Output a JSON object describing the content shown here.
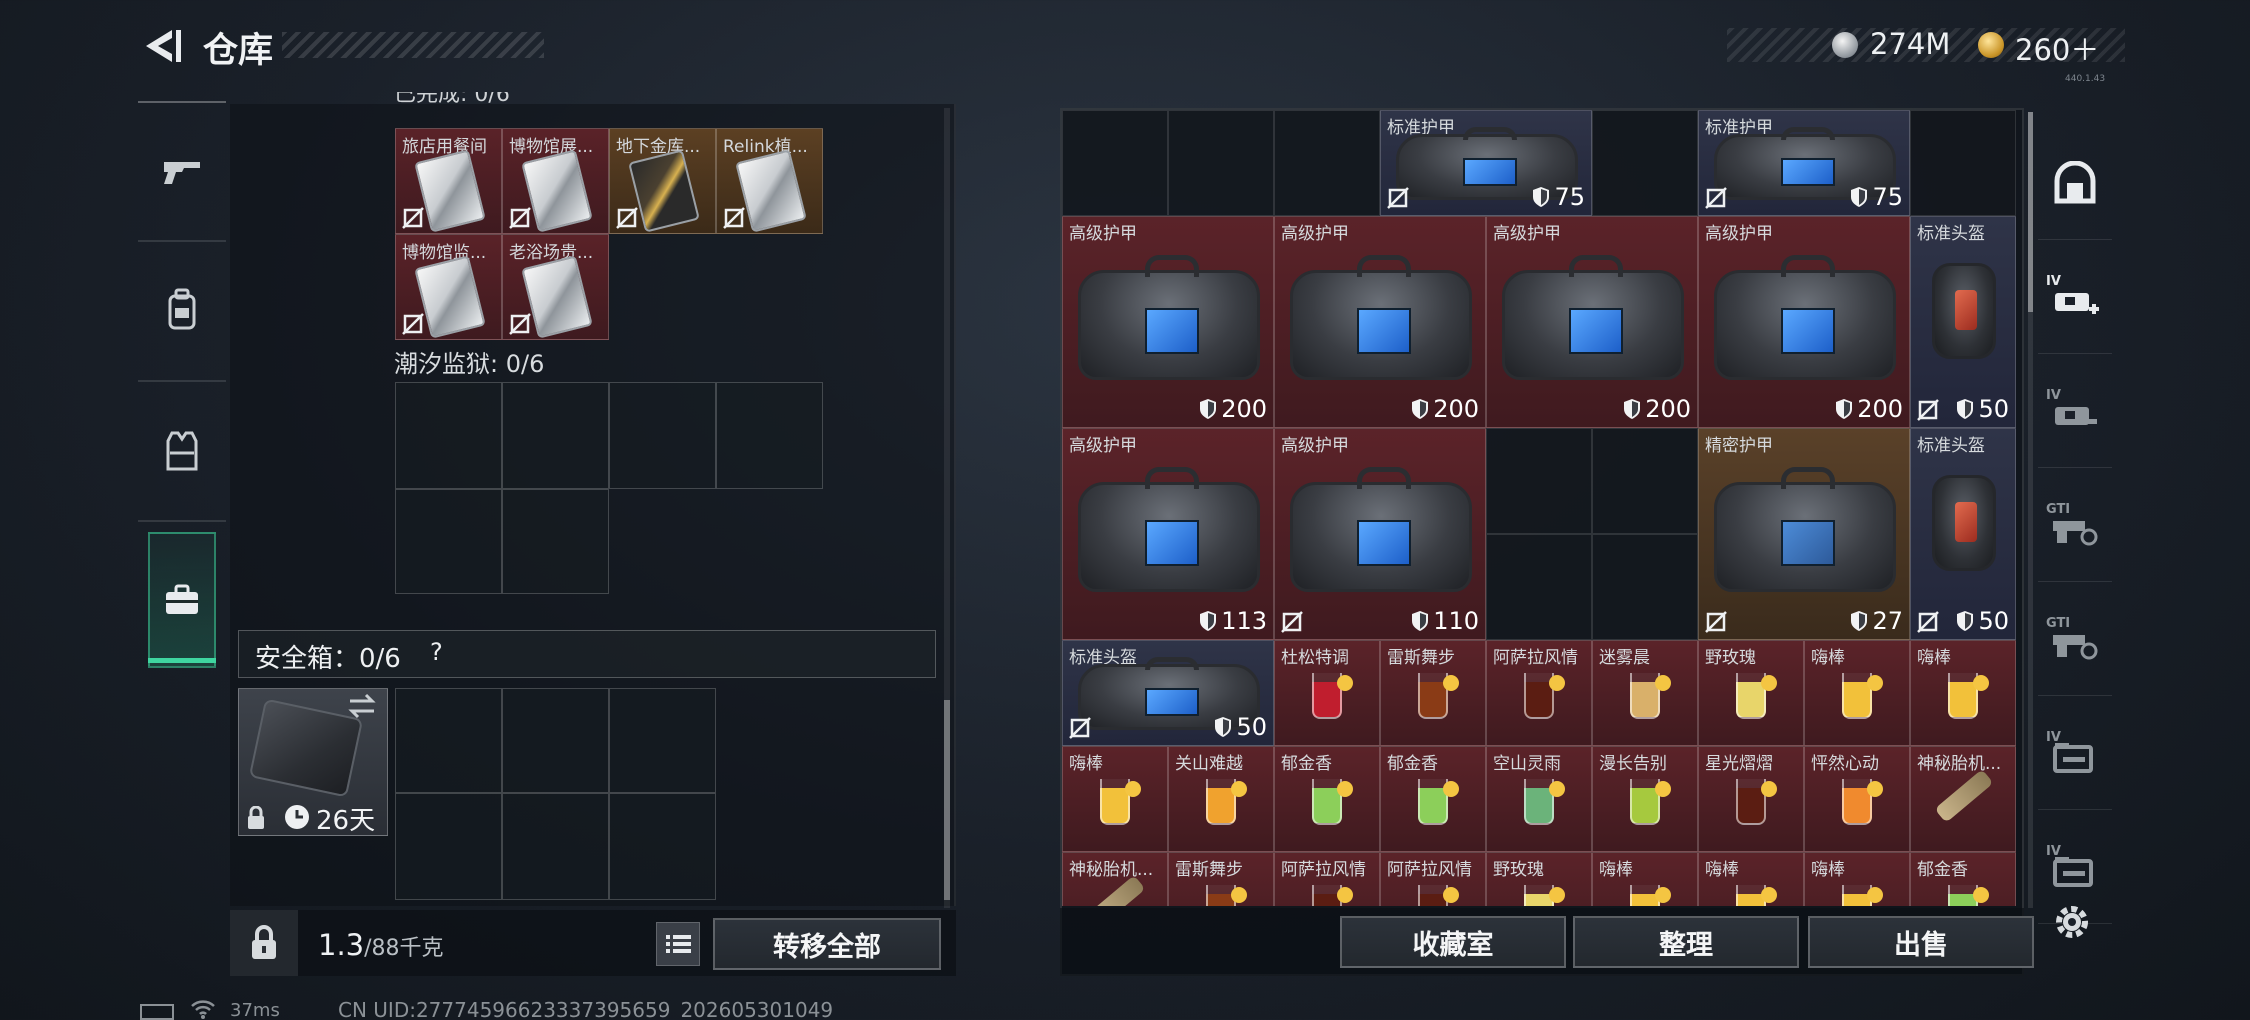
{
  "header": {
    "title": "仓库",
    "currency_silver": "274M",
    "currency_gold": "260＋",
    "tiny_text": "440.1.43"
  },
  "left_nav": {
    "items": [
      "weapons-icon",
      "backpack-icon",
      "vest-icon",
      "toolbox-icon"
    ],
    "active": "toolbox-icon"
  },
  "left_panel": {
    "cut_label": "已完成: 0/6",
    "cards": [
      {
        "name": "旅店用餐间",
        "tone": "red",
        "style": "white"
      },
      {
        "name": "博物馆展...",
        "tone": "red",
        "style": "white"
      },
      {
        "name": "地下金库...",
        "tone": "gold",
        "style": "black"
      },
      {
        "name": "Relink植...",
        "tone": "gold",
        "style": "white"
      },
      {
        "name": "博物馆监...",
        "tone": "red",
        "style": "white"
      },
      {
        "name": "老浴场贵...",
        "tone": "red",
        "style": "white"
      }
    ],
    "prison_label": "潮汐监狱: 0/6",
    "safe_box_label": "安全箱：0/6",
    "safe_help": "?",
    "case_days": "26天",
    "weight_value": "1.3",
    "weight_unit": "/88千克",
    "transfer_button": "转移全部"
  },
  "grid": {
    "items": [
      {
        "name": "标准护甲",
        "kind": "bag",
        "tone": "blue",
        "col": 3,
        "row": 0,
        "w": 2,
        "h": 1,
        "dur": "75",
        "noseal": true
      },
      {
        "name": "标准护甲",
        "kind": "bag",
        "tone": "blue",
        "col": 6,
        "row": 0,
        "w": 2,
        "h": 1,
        "dur": "75",
        "noseal": true
      },
      {
        "name": "高级护甲",
        "kind": "bag",
        "tone": "red",
        "col": 0,
        "row": 1,
        "w": 2,
        "h": 2,
        "dur": "200",
        "noseal": false
      },
      {
        "name": "高级护甲",
        "kind": "bag",
        "tone": "red",
        "col": 2,
        "row": 1,
        "w": 2,
        "h": 2,
        "dur": "200",
        "noseal": false
      },
      {
        "name": "高级护甲",
        "kind": "bag",
        "tone": "red",
        "col": 4,
        "row": 1,
        "w": 2,
        "h": 2,
        "dur": "200",
        "noseal": false
      },
      {
        "name": "高级护甲",
        "kind": "bag",
        "tone": "red",
        "col": 6,
        "row": 1,
        "w": 2,
        "h": 2,
        "dur": "200",
        "noseal": false
      },
      {
        "name": "标准头盔",
        "kind": "helmet",
        "tone": "blue",
        "col": 8,
        "row": 1,
        "w": 1,
        "h": 2,
        "dur": "50",
        "noseal": true
      },
      {
        "name": "高级护甲",
        "kind": "bag",
        "tone": "red",
        "col": 0,
        "row": 3,
        "w": 2,
        "h": 2,
        "dur": "113",
        "noseal": false
      },
      {
        "name": "高级护甲",
        "kind": "bag",
        "tone": "red",
        "col": 2,
        "row": 3,
        "w": 2,
        "h": 2,
        "dur": "110",
        "noseal": true
      },
      {
        "name": "精密护甲",
        "kind": "bag",
        "tone": "gold",
        "col": 6,
        "row": 3,
        "w": 2,
        "h": 2,
        "dur": "27",
        "noseal": true
      },
      {
        "name": "标准头盔",
        "kind": "helmet",
        "tone": "blue",
        "col": 8,
        "row": 3,
        "w": 1,
        "h": 2,
        "dur": "50",
        "noseal": true
      },
      {
        "name": "标准头盔",
        "kind": "bag",
        "tone": "blue",
        "col": 0,
        "row": 5,
        "w": 2,
        "h": 1,
        "dur": "50",
        "noseal": true
      },
      {
        "name": "杜松特调",
        "kind": "drink",
        "tone": "red",
        "col": 2,
        "row": 5,
        "w": 1,
        "h": 1,
        "fruit": "#c01e2e"
      },
      {
        "name": "雷斯舞步",
        "kind": "drink",
        "tone": "red",
        "col": 3,
        "row": 5,
        "w": 1,
        "h": 1,
        "fruit": "#8a3b16"
      },
      {
        "name": "阿萨拉风情",
        "kind": "drink",
        "tone": "red",
        "col": 4,
        "row": 5,
        "w": 1,
        "h": 1,
        "fruit": "#5b1d12"
      },
      {
        "name": "迷雾晨",
        "kind": "drink",
        "tone": "red",
        "col": 5,
        "row": 5,
        "w": 1,
        "h": 1,
        "fruit": "#d9b06a"
      },
      {
        "name": "野玫瑰",
        "kind": "drink",
        "tone": "red",
        "col": 6,
        "row": 5,
        "w": 1,
        "h": 1,
        "fruit": "#e8d56a"
      },
      {
        "name": "嗨棒",
        "kind": "drink",
        "tone": "red",
        "col": 7,
        "row": 5,
        "w": 1,
        "h": 1,
        "fruit": "#f2c13a"
      },
      {
        "name": "嗨棒",
        "kind": "drink",
        "tone": "red",
        "col": 8,
        "row": 5,
        "w": 1,
        "h": 1,
        "fruit": "#f2c13a"
      },
      {
        "name": "嗨棒",
        "kind": "drink",
        "tone": "red",
        "col": 0,
        "row": 6,
        "w": 1,
        "h": 1,
        "fruit": "#f2c13a"
      },
      {
        "name": "关山难越",
        "kind": "drink",
        "tone": "red",
        "col": 1,
        "row": 6,
        "w": 1,
        "h": 1,
        "fruit": "#f0a22e"
      },
      {
        "name": "郁金香",
        "kind": "drink",
        "tone": "red",
        "col": 2,
        "row": 6,
        "w": 1,
        "h": 1,
        "fruit": "#8ccf5a"
      },
      {
        "name": "郁金香",
        "kind": "drink",
        "tone": "red",
        "col": 3,
        "row": 6,
        "w": 1,
        "h": 1,
        "fruit": "#8ccf5a"
      },
      {
        "name": "空山灵雨",
        "kind": "drink",
        "tone": "red",
        "col": 4,
        "row": 6,
        "w": 1,
        "h": 1,
        "fruit": "#6bb37a"
      },
      {
        "name": "漫长告别",
        "kind": "drink",
        "tone": "red",
        "col": 5,
        "row": 6,
        "w": 1,
        "h": 1,
        "fruit": "#a6c93e"
      },
      {
        "name": "星光熠熠",
        "kind": "drink",
        "tone": "red",
        "col": 6,
        "row": 6,
        "w": 1,
        "h": 1,
        "fruit": "#5b1d12"
      },
      {
        "name": "怦然心动",
        "kind": "drink",
        "tone": "red",
        "col": 7,
        "row": 6,
        "w": 1,
        "h": 1,
        "fruit": "#f08a2e"
      },
      {
        "name": "神秘胎机...",
        "kind": "tool",
        "tone": "red",
        "col": 8,
        "row": 6,
        "w": 1,
        "h": 1
      },
      {
        "name": "神秘胎机...",
        "kind": "tool",
        "tone": "red",
        "col": 0,
        "row": 7,
        "w": 1,
        "h": 1
      },
      {
        "name": "雷斯舞步",
        "kind": "drink",
        "tone": "red",
        "col": 1,
        "row": 7,
        "w": 1,
        "h": 1,
        "fruit": "#8a3b16"
      },
      {
        "name": "阿萨拉风情",
        "kind": "drink",
        "tone": "red",
        "col": 2,
        "row": 7,
        "w": 1,
        "h": 1,
        "fruit": "#5b1d12"
      },
      {
        "name": "阿萨拉风情",
        "kind": "drink",
        "tone": "red",
        "col": 3,
        "row": 7,
        "w": 1,
        "h": 1,
        "fruit": "#5b1d12"
      },
      {
        "name": "野玫瑰",
        "kind": "drink",
        "tone": "red",
        "col": 4,
        "row": 7,
        "w": 1,
        "h": 1,
        "fruit": "#e8d56a"
      },
      {
        "name": "嗨棒",
        "kind": "drink",
        "tone": "red",
        "col": 5,
        "row": 7,
        "w": 1,
        "h": 1,
        "fruit": "#f2c13a"
      },
      {
        "name": "嗨棒",
        "kind": "drink",
        "tone": "red",
        "col": 6,
        "row": 7,
        "w": 1,
        "h": 1,
        "fruit": "#f2c13a"
      },
      {
        "name": "嗨棒",
        "kind": "drink",
        "tone": "red",
        "col": 7,
        "row": 7,
        "w": 1,
        "h": 1,
        "fruit": "#f2c13a"
      },
      {
        "name": "郁金香",
        "kind": "drink",
        "tone": "red",
        "col": 8,
        "row": 7,
        "w": 1,
        "h": 1,
        "fruit": "#8ccf5a"
      }
    ]
  },
  "bottom_right": {
    "collection": "收藏室",
    "organize": "整理",
    "sell": "出售"
  },
  "right_nav": {
    "items": [
      "armor-icon",
      "armor-add-icon",
      "armor-gun-icon",
      "gun-search-icon",
      "gun-config-icon",
      "folder-icon",
      "gun-folder-icon"
    ],
    "labels": [
      "",
      "IV",
      "IV",
      "GTI",
      "GTI",
      "IV",
      "IV"
    ]
  },
  "status": {
    "ping": "37ms",
    "uid": "CN UID:2777459662333739565​9_202605301049"
  }
}
